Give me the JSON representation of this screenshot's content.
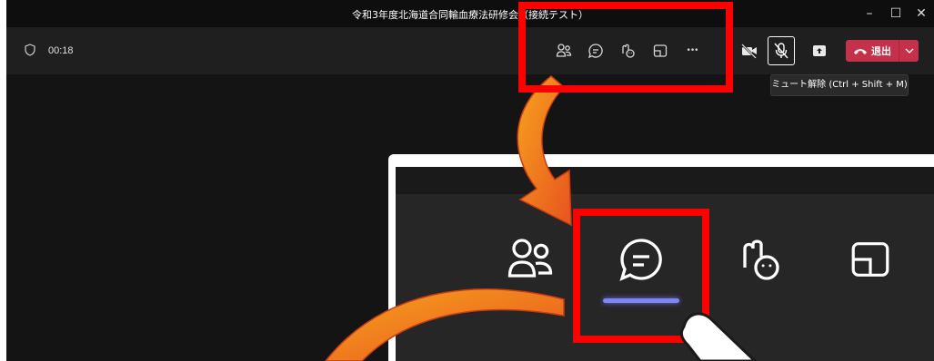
{
  "window": {
    "title": "令和3年度北海道合同輸血療法研修会（接続テスト）",
    "minimize_glyph": "–",
    "maximize_glyph": "☐",
    "close_glyph": "✕"
  },
  "toolbar": {
    "timer": "00:18",
    "icons": [
      "shield-icon",
      "participants-icon",
      "chat-icon",
      "raise-hand-icon",
      "share-tray-icon",
      "more-options-icon",
      "camera-off-icon",
      "mic-muted-icon",
      "share-content-icon"
    ],
    "more_glyph": "•••",
    "leave_label": "退出",
    "leave_color": "#c4314b"
  },
  "tooltip": {
    "text": "ミュート解除 (Ctrl + Shift + M)"
  },
  "zoom_panel": {
    "icons": [
      "participants-icon",
      "chat-icon",
      "raise-hand-icon",
      "share-tray-icon"
    ],
    "active_underline_color": "#7f85f5"
  },
  "annotations": {
    "highlight_color": "#ff0000",
    "arrow_color": "#f28b24"
  }
}
